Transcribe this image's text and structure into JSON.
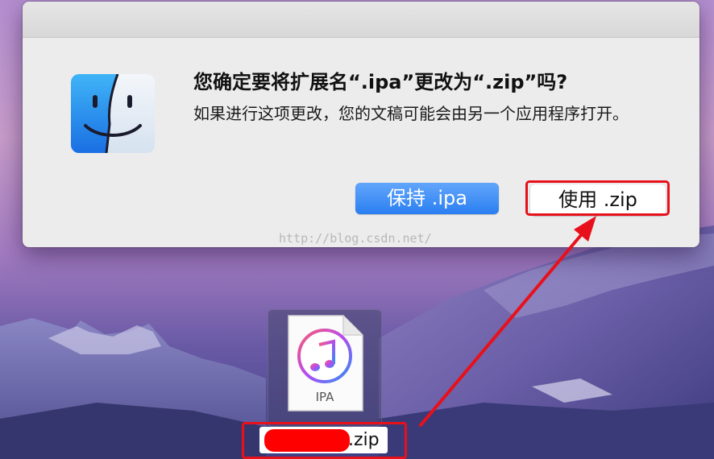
{
  "dialog": {
    "title": "您确定要将扩展名“.ipa”更改为“.zip”吗?",
    "message": "如果进行这项更改，您的文稿可能会由另一个应用程序打开。",
    "keep_button_label": "保持 .ipa",
    "use_button_label": "使用 .zip",
    "app_icon": "finder-icon"
  },
  "watermark": "http://blog.csdn.net/",
  "file": {
    "icon_label": "IPA",
    "icon": "itunes-music-icon",
    "name_suffix": ".zip"
  },
  "colors": {
    "primary_button": "#2a7ef1",
    "annotation_red": "#e8101a",
    "redaction": "#ff0000"
  }
}
